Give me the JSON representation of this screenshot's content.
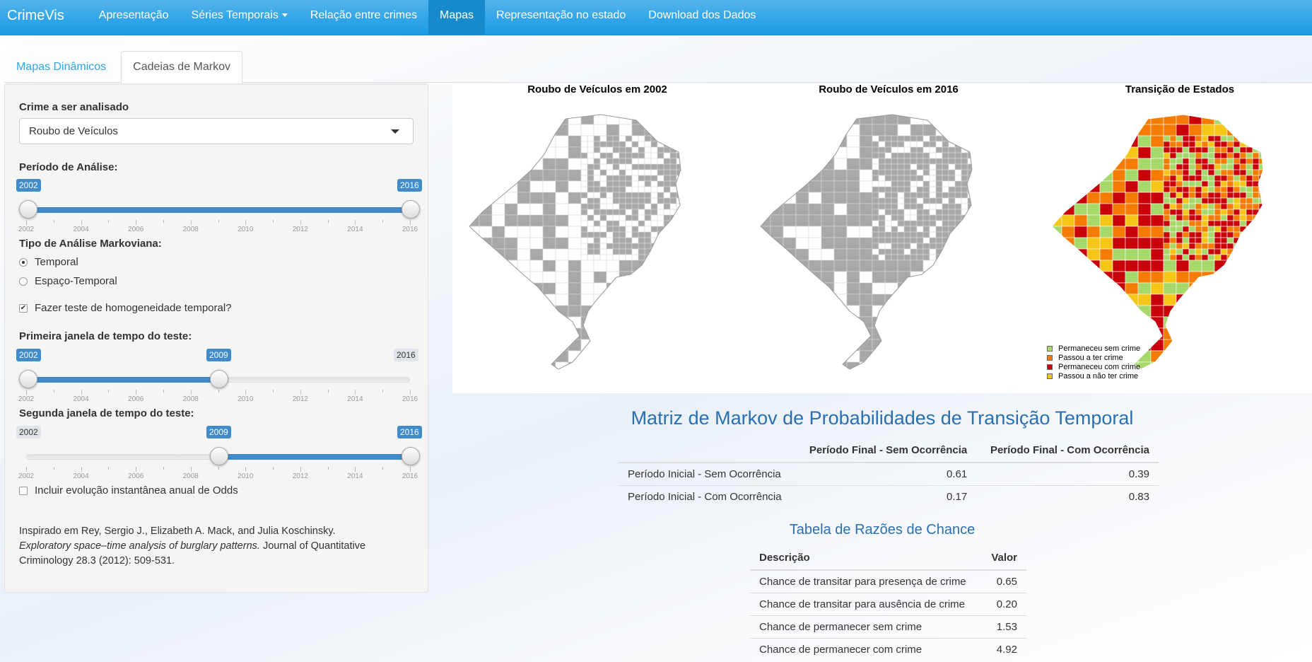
{
  "navbar": {
    "brand": "CrimeVis",
    "items": [
      {
        "label": "Apresentação"
      },
      {
        "label": "Séries Temporais"
      },
      {
        "label": "Relação entre crimes"
      },
      {
        "label": "Mapas"
      },
      {
        "label": "Representação no estado"
      },
      {
        "label": "Download dos Dados"
      }
    ],
    "active": "Mapas"
  },
  "tabs": [
    {
      "label": "Mapas Dinâmicos"
    },
    {
      "label": "Cadeias de Markov"
    }
  ],
  "sidebar": {
    "crime_label": "Crime a ser analisado",
    "crime_value": "Roubo de Veículos",
    "period_label": "Período de Análise:",
    "period_from": "2002",
    "period_to": "2016",
    "tick_labels": [
      "2002",
      "2004",
      "2006",
      "2008",
      "2010",
      "2012",
      "2014",
      "2016"
    ],
    "analysis_label": "Tipo de Análise Markoviana:",
    "radio_temporal": "Temporal",
    "radio_spatial": "Espaço-Temporal",
    "homog_label": "Fazer teste de homogeneidade temporal?",
    "w1_label": "Primeira janela de tempo do teste:",
    "w1_from": "2002",
    "w1_to": "2009",
    "w1_max": "2016",
    "w2_label": "Segunda janela de tempo do teste:",
    "w2_min": "2002",
    "w2_from": "2009",
    "w2_to": "2016",
    "odds_label": "Incluir evolução instantânea anual de Odds",
    "ref_1": "Inspirado em Rey, Sergio J., Elizabeth A. Mack, and Julia Koschinsky.",
    "ref_2": "Exploratory space–time analysis of burglary patterns.",
    "ref_3": " Journal of Quantitative Criminology 28.3 (2012): 509-531."
  },
  "maps": {
    "title_1": "Roubo de Veículos em 2002",
    "title_2": "Roubo de Veículos em 2016",
    "title_3": "Transição de Estados",
    "legend": [
      {
        "label": "Permaneceu sem crime",
        "color": "#a6d96a"
      },
      {
        "label": "Passou a ter crime",
        "color": "#f57c00"
      },
      {
        "label": "Permaneceu com crime",
        "color": "#c8000a"
      },
      {
        "label": "Passou a não ter crime",
        "color": "#f5c518"
      }
    ],
    "grey": "#a8a8a8"
  },
  "markov": {
    "title": "Matriz de Markov de Probabilidades de Transição Temporal",
    "col_1": "Período Final - Sem Ocorrência",
    "col_2": "Período Final - Com Ocorrência",
    "rows": [
      {
        "label": "Período Inicial - Sem Ocorrência",
        "v1": "0.61",
        "v2": "0.39"
      },
      {
        "label": "Período Inicial - Com Ocorrência",
        "v1": "0.17",
        "v2": "0.83"
      }
    ]
  },
  "odds": {
    "title": "Tabela de Razões de Chance",
    "col_desc": "Descrição",
    "col_val": "Valor",
    "rows": [
      {
        "label": "Chance de transitar para presença de crime",
        "value": "0.65"
      },
      {
        "label": "Chance de transitar para ausência de crime",
        "value": "0.20"
      },
      {
        "label": "Chance de permanecer sem crime",
        "value": "1.53"
      },
      {
        "label": "Chance de permanecer com crime",
        "value": "4.92"
      }
    ]
  }
}
